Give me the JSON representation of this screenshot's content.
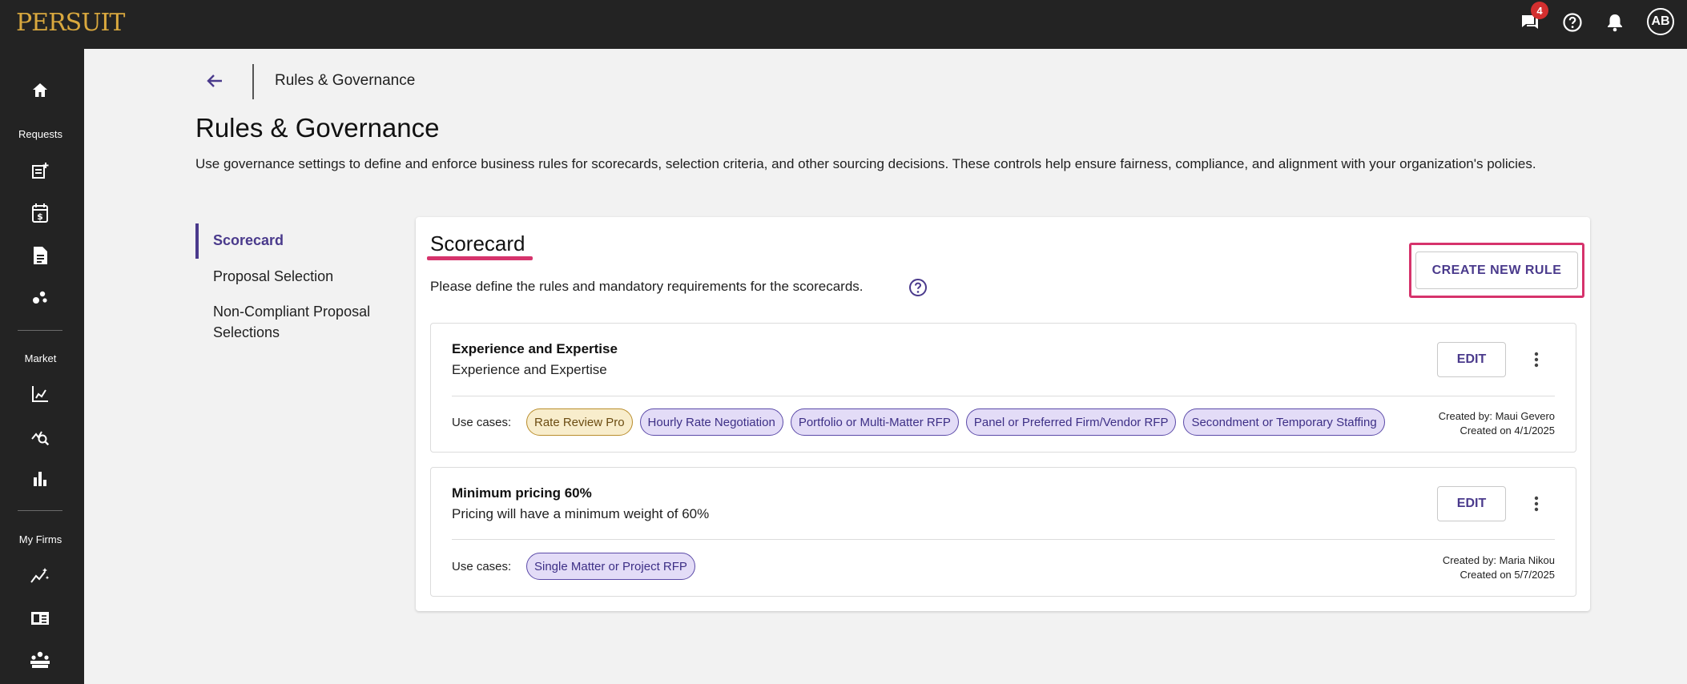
{
  "app": {
    "logo": "PERSUIT",
    "message_badge": "4",
    "avatar_initials": "AB",
    "accent_color": "#4a3a8c",
    "highlight_color": "#d6336c"
  },
  "topbar_icons": [
    "chat-icon",
    "help-icon",
    "bell-icon"
  ],
  "sidebar": {
    "home_icon": "home-icon",
    "sections": [
      {
        "label": "Requests",
        "icons": [
          "new-request-icon",
          "calendar-dollar-icon",
          "document-icon",
          "scatter-icon"
        ]
      },
      {
        "label": "Market",
        "icons": [
          "chart-axis-icon",
          "search-analytics-icon",
          "bar-chart-icon"
        ]
      },
      {
        "label": "My Firms",
        "icons": [
          "wand-chart-icon",
          "id-card-icon",
          "team-icon"
        ]
      }
    ]
  },
  "breadcrumb": {
    "label": "Rules & Governance"
  },
  "page": {
    "title": "Rules & Governance",
    "description": "Use governance settings to define and enforce business rules for scorecards, selection criteria, and other sourcing decisions. These controls help ensure fairness, compliance, and alignment with your organization's policies."
  },
  "nav": {
    "items": [
      {
        "label": "Scorecard",
        "active": true
      },
      {
        "label": "Proposal Selection",
        "active": false
      },
      {
        "label": "Non-Compliant Proposal Selections",
        "active": false
      }
    ]
  },
  "card": {
    "title": "Scorecard",
    "subtitle": "Please define the rules and mandatory requirements for the scorecards.",
    "create_button": "CREATE NEW RULE",
    "use_cases_label": "Use cases:",
    "edit_label": "EDIT",
    "rules": [
      {
        "name": "Experience and Expertise",
        "description": "Experience and Expertise",
        "use_cases": [
          {
            "label": "Rate Review Pro",
            "style": "amber"
          },
          {
            "label": "Hourly Rate Negotiation",
            "style": "purple"
          },
          {
            "label": "Portfolio or Multi-Matter RFP",
            "style": "purple"
          },
          {
            "label": "Panel or Preferred Firm/Vendor RFP",
            "style": "purple"
          },
          {
            "label": "Secondment or Temporary Staffing",
            "style": "purple"
          }
        ],
        "created_by": "Created by: Maui Gevero",
        "created_on": "Created on 4/1/2025"
      },
      {
        "name": "Minimum pricing 60%",
        "description": "Pricing will have a minimum weight of 60%",
        "use_cases": [
          {
            "label": "Single Matter or Project RFP",
            "style": "purple"
          }
        ],
        "created_by": "Created by: Maria Nikou",
        "created_on": "Created on 5/7/2025"
      }
    ]
  }
}
